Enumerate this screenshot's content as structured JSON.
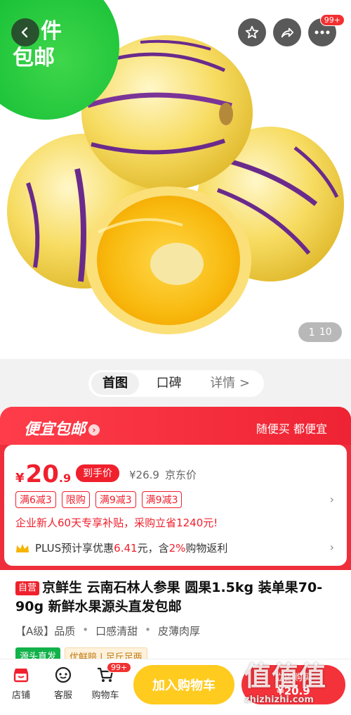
{
  "header": {
    "corner_tag_line1": "件",
    "corner_tag_line2": "包邮",
    "more_badge": "99+",
    "image_counter_current": "1",
    "image_counter_total": "10"
  },
  "tabs": [
    {
      "label": "首图"
    },
    {
      "label": "口碑"
    },
    {
      "label": "详情 >"
    }
  ],
  "promo": {
    "title": "便宜包邮",
    "slogan": "随便买 都便宜",
    "price_symbol": "¥",
    "price_int": "20",
    "price_dec": ".9",
    "hand_price_label": "到手价",
    "jd_price": "¥26.9",
    "jd_price_label": "京东价",
    "coupons": [
      "满6减3",
      "限购",
      "满9减3",
      "满9减3"
    ],
    "subsidy": "企业新人60天专享补贴，采购立省1240元!",
    "plus_prefix": "PLUS预计享优惠",
    "plus_amount": "6.41",
    "plus_mid": "元，含",
    "plus_rate": "2%",
    "plus_suffix": "购物返利"
  },
  "product": {
    "self_tag": "自营",
    "title": "京鲜生 云南石林人参果 圆果1.5kg 装单果70-90g  新鲜水果源头直发包邮",
    "attrs": [
      "【A级】品质",
      "•",
      "口感清甜",
      "•",
      "皮薄肉厚"
    ],
    "tag_source": "源头直发",
    "tag_fresh": "优鲜赔 | 足斤足两"
  },
  "bottom_bar": {
    "shop": "店铺",
    "service": "客服",
    "cart": "购物车",
    "cart_badge": "99+",
    "add_to_cart": "加入购物车",
    "buy_now_line1": "立即购买",
    "buy_now_line2": "¥20.9"
  },
  "watermark": {
    "logo": "值值值",
    "url": "zhizhizhi.com"
  },
  "colors": {
    "accent_red": "#f0202d",
    "cart_yellow": "#ffcb1f",
    "tag_green": "#1ec43a"
  }
}
